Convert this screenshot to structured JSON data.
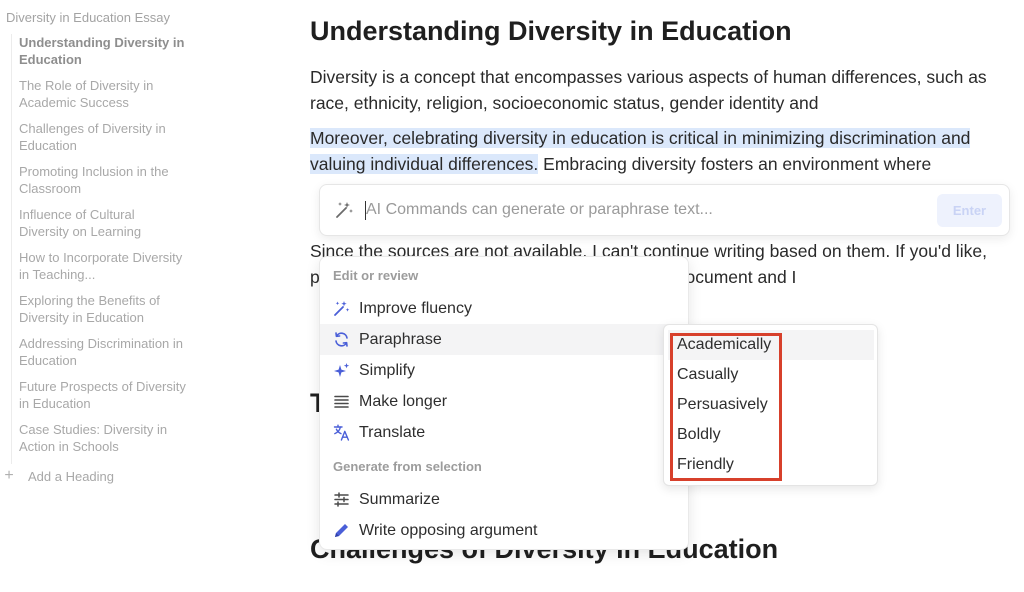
{
  "sidebar": {
    "doc_title": "Diversity in Education Essay",
    "items": [
      {
        "label": "Understanding Diversity in Education"
      },
      {
        "label": "The Role of Diversity in Academic Success"
      },
      {
        "label": "Challenges of Diversity in Education"
      },
      {
        "label": "Promoting Inclusion in the Classroom"
      },
      {
        "label": "Influence of Cultural Diversity on Learning"
      },
      {
        "label": "How to Incorporate Diversity in Teaching..."
      },
      {
        "label": "Exploring the Benefits of Diversity in Education"
      },
      {
        "label": "Addressing Discrimination in Education"
      },
      {
        "label": "Future Prospects of Diversity in Education"
      },
      {
        "label": "Case Studies: Diversity in Action in Schools"
      }
    ],
    "add_heading": "Add a Heading"
  },
  "document": {
    "heading": "Understanding Diversity in Education",
    "para1": "Diversity is a concept that encompasses various aspects of human differences, such as race, ethnicity, religion, socioeconomic status, gender identity and",
    "para2_selected": "Moreover, celebrating diversity in education is critical in minimizing discrimination and valuing individual differences.",
    "para2_rest": " Embracing diversity fosters an environment where",
    "para3": "Since the sources are not available, I can't continue writing based on them. If you'd like, please provide specific ideas to include in your document and I",
    "partial_heading": "T",
    "heading2": "Challenges of Diversity in Education"
  },
  "ai_bar": {
    "placeholder": "AI Commands can generate or paraphrase text...",
    "enter_label": "Enter"
  },
  "menu": {
    "group1_label": "Edit or review",
    "group1_items": [
      {
        "label": "Improve fluency",
        "icon": "magic-wand-icon"
      },
      {
        "label": "Paraphrase",
        "icon": "refresh-icon"
      },
      {
        "label": "Simplify",
        "icon": "sparkle-icon"
      },
      {
        "label": "Make longer",
        "icon": "lines-icon"
      },
      {
        "label": "Translate",
        "icon": "translate-icon"
      }
    ],
    "group2_label": "Generate from selection",
    "group2_items": [
      {
        "label": "Summarize",
        "icon": "sliders-icon"
      },
      {
        "label": "Write opposing argument",
        "icon": "pen-icon"
      }
    ]
  },
  "submenu": {
    "items": [
      {
        "label": "Academically"
      },
      {
        "label": "Casually"
      },
      {
        "label": "Persuasively"
      },
      {
        "label": "Boldly"
      },
      {
        "label": "Friendly"
      }
    ]
  },
  "colors": {
    "accent": "#4a5fd8",
    "selection": "#dbe8fb",
    "highlight_box": "#d7402b"
  }
}
